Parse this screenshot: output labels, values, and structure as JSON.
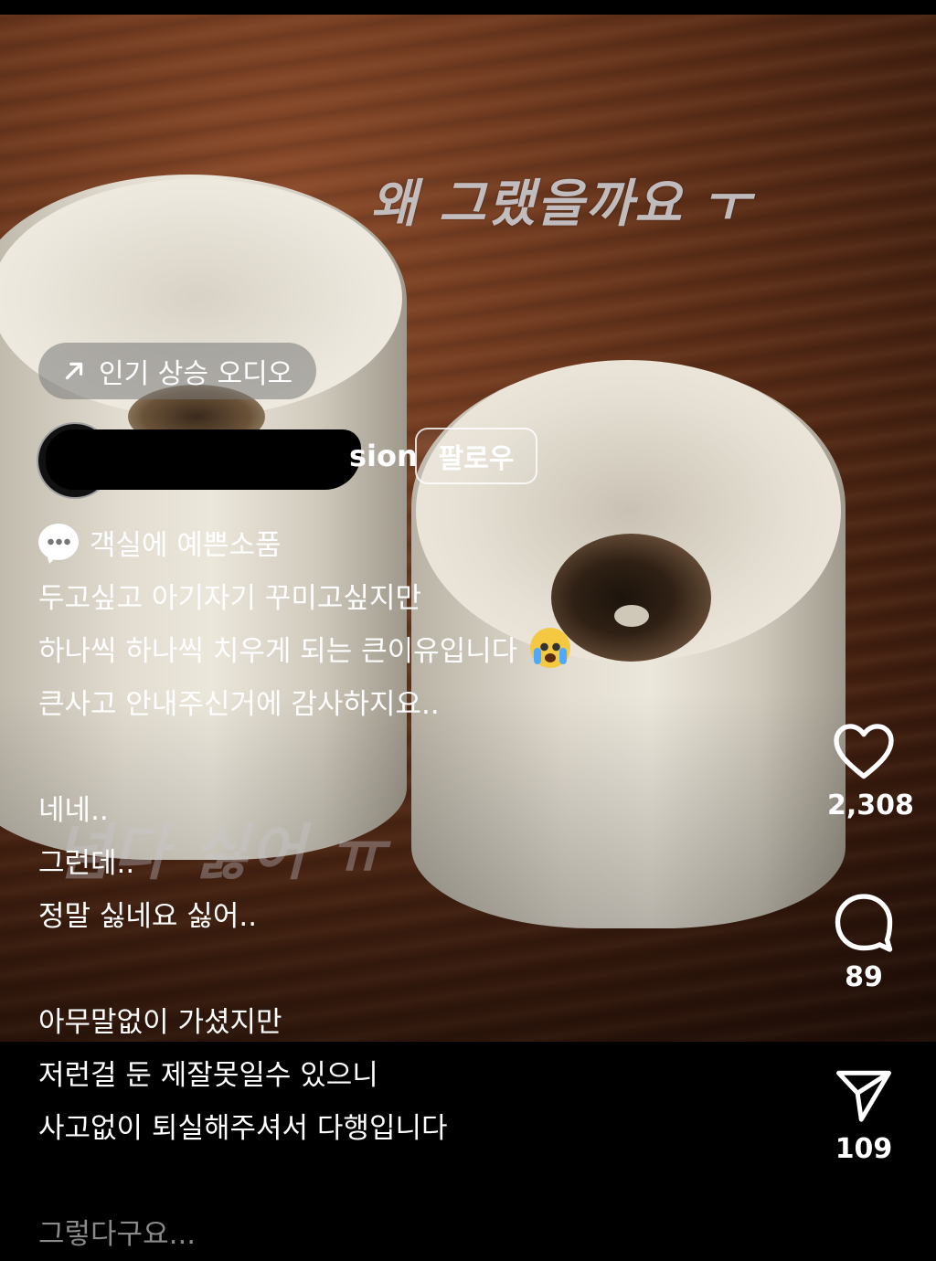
{
  "reel": {
    "overlay_text_top": "왜 그랬을까요 ㅜ",
    "overlay_text_mid": "넘다 싫어 ㅠ",
    "trending_audio": {
      "icon": "arrow-up-right-icon",
      "label": "인기 상승 오디오"
    },
    "author": {
      "username_visible": "sion",
      "follow_label": "팔로우"
    },
    "caption_lines": [
      "객실에 예쁜소품",
      "두고싶고 아기자기 꾸미고싶지만",
      "하나씩 하나씩 치우게 되는 큰이유입니다",
      "큰사고 안내주신거에 감사하지요..",
      "",
      "네네..",
      "그런데..",
      "정말 싫네요 싫어..",
      "",
      "아무말없이 가셨지만",
      "저런걸 둔 제잘못일수 있으니",
      "사고없이 퇴실해주셔서 다행입니다",
      "",
      "그렇다구요..."
    ],
    "actions": {
      "like_count": "2,308",
      "comment_count": "89",
      "share_count": "109"
    }
  }
}
